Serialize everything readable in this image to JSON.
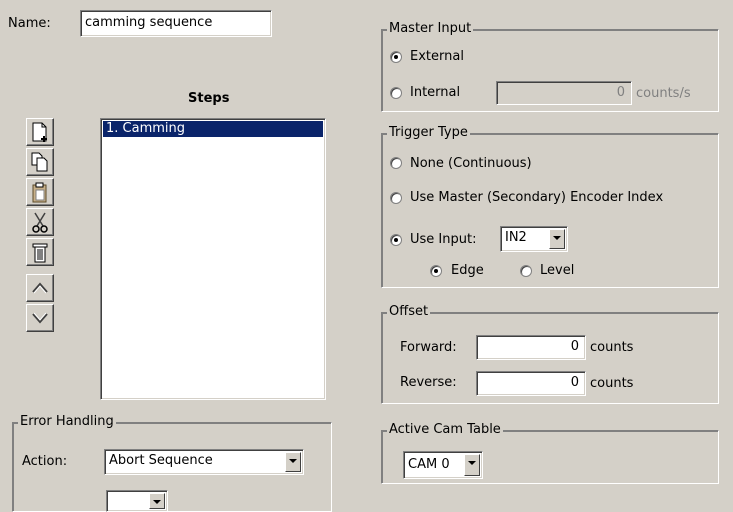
{
  "name": {
    "label": "Name:",
    "value": "camming sequence"
  },
  "steps": {
    "title": "Steps",
    "items": [
      "1. Camming"
    ],
    "toolbar_icons": [
      "new-step-icon",
      "copy-icon",
      "paste-icon",
      "cut-icon",
      "delete-icon",
      "move-up-icon",
      "move-down-icon"
    ]
  },
  "error_handling": {
    "title": "Error Handling",
    "action_label": "Action:",
    "action_value": "Abort Sequence"
  },
  "master_input": {
    "title": "Master Input",
    "external_label": "External",
    "internal_label": "Internal",
    "internal_value": "0",
    "internal_unit": "counts/s",
    "selected": "External"
  },
  "trigger_type": {
    "title": "Trigger Type",
    "none_label": "None (Continuous)",
    "encoder_label": "Use Master (Secondary) Encoder Index",
    "input_label": "Use Input:",
    "input_value": "IN2",
    "edge_label": "Edge",
    "level_label": "Level",
    "selected": "Use Input",
    "mode_selected": "Edge"
  },
  "offset": {
    "title": "Offset",
    "forward_label": "Forward:",
    "forward_value": "0",
    "reverse_label": "Reverse:",
    "reverse_value": "0",
    "unit": "counts"
  },
  "active_cam_table": {
    "title": "Active Cam Table",
    "value": "CAM 0"
  },
  "colors": {
    "background": "#d4d0c8",
    "selection": "#0a246a"
  }
}
